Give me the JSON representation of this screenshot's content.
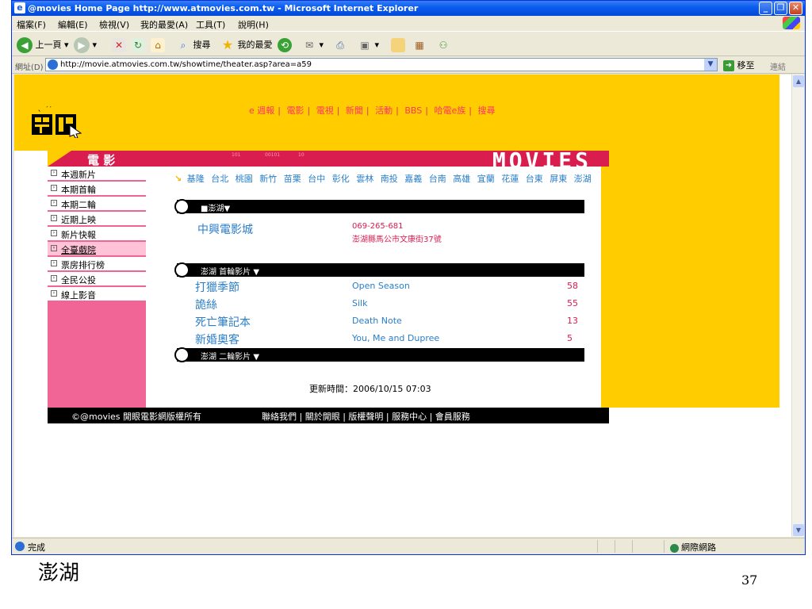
{
  "window": {
    "title": "@movies Home Page http://www.atmovies.com.tw - Microsoft Internet Explorer",
    "minimize": "_",
    "maximize": "❐",
    "close": "✕"
  },
  "menubar": [
    "檔案(F)",
    "編輯(E)",
    "檢視(V)",
    "我的最愛(A)",
    "工具(T)",
    "說明(H)"
  ],
  "toolbar": {
    "back": "上一頁",
    "search": "搜尋",
    "favorites": "我的最愛"
  },
  "address": {
    "label": "網址(D)",
    "url": "http://movie.atmovies.com.tw/showtime/theater.asp?area=a59",
    "go": "移至",
    "links": "連結"
  },
  "site": {
    "top_nav": [
      "e 週報",
      "電影",
      "電視",
      "新聞",
      "活動",
      "BBS",
      "哈電e族",
      "搜尋"
    ],
    "section_label": "電 影",
    "banner_text": "MOVIES",
    "side_menu": [
      "本週新片",
      "本期首輪",
      "本期二輪",
      "近期上映",
      "新片快報",
      "全臺戲院",
      "票房排行榜",
      "全民公投",
      "線上影音"
    ],
    "side_menu_active_index": 5,
    "regions": [
      "基隆",
      "台北",
      "桃園",
      "新竹",
      "苗栗",
      "台中",
      "彰化",
      "雲林",
      "南投",
      "嘉義",
      "台南",
      "高雄",
      "宜蘭",
      "花蓮",
      "台東",
      "屏東",
      "澎湖"
    ],
    "area_bar": "■澎湖▼",
    "theater": {
      "name": "中興電影城",
      "phone": "069-265-681",
      "address": "澎湖縣馬公市文康街37號"
    },
    "first_run_bar": "澎湖 首輪影片 ▼",
    "films": [
      {
        "zh": "打獵季節",
        "en": "Open Season",
        "count": "58"
      },
      {
        "zh": "詭絲",
        "en": "Silk",
        "count": "55"
      },
      {
        "zh": "死亡筆記本",
        "en": "Death Note",
        "count": "13"
      },
      {
        "zh": "新婚奧客",
        "en": "You, Me and Dupree",
        "count": "5"
      }
    ],
    "second_run_bar": "澎湖 二輪影片 ▼",
    "updated": "更新時間：2006/10/15 07:03",
    "footer_copy": "©@movies 開眼電影網版權所有",
    "footer_links": "聯絡我們 | 關於開眼 | 版權聲明 | 服務中心 | 會員服務"
  },
  "status": {
    "left": "完成",
    "zone": "網際網路"
  },
  "slide": {
    "caption": "澎湖",
    "page_number": "37"
  }
}
